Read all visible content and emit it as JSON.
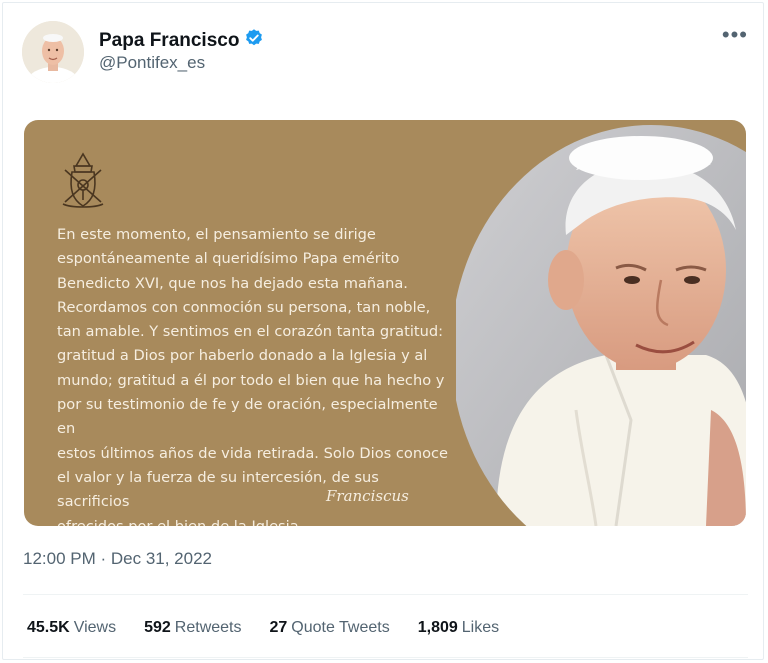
{
  "tweet": {
    "author": {
      "name": "Papa Francisco",
      "handle": "@Pontifex_es",
      "verified_color": "#1d9bf0"
    },
    "more_icon": "more-horizontal-icon",
    "card": {
      "background_color": "#a88a5c",
      "text_lines": [
        "En este momento, el pensamiento se dirige",
        "espontáneamente al queridísimo Papa emérito",
        "Benedicto XVI, que nos ha dejado esta mañana.",
        "Recordamos con conmoción su persona, tan noble,",
        "tan amable. Y sentimos en el corazón tanta gratitud:",
        "gratitud a Dios por haberlo donado a la Iglesia y al",
        "mundo; gratitud a él por todo el bien que ha hecho y",
        "por su testimonio de fe y de oración, especialmente en",
        "estos últimos años de vida retirada. Solo Dios conoce",
        "el valor y la fuerza de su intercesión, de sus sacrificios",
        "ofrecidos por el bien de la Iglesia."
      ],
      "signature": "Franciscus"
    },
    "timestamp": "12:00 PM · Dec 31, 2022",
    "stats": [
      {
        "count": "45.5K",
        "label": "Views"
      },
      {
        "count": "592",
        "label": "Retweets"
      },
      {
        "count": "27",
        "label": "Quote Tweets"
      },
      {
        "count": "1,809",
        "label": "Likes"
      }
    ]
  }
}
